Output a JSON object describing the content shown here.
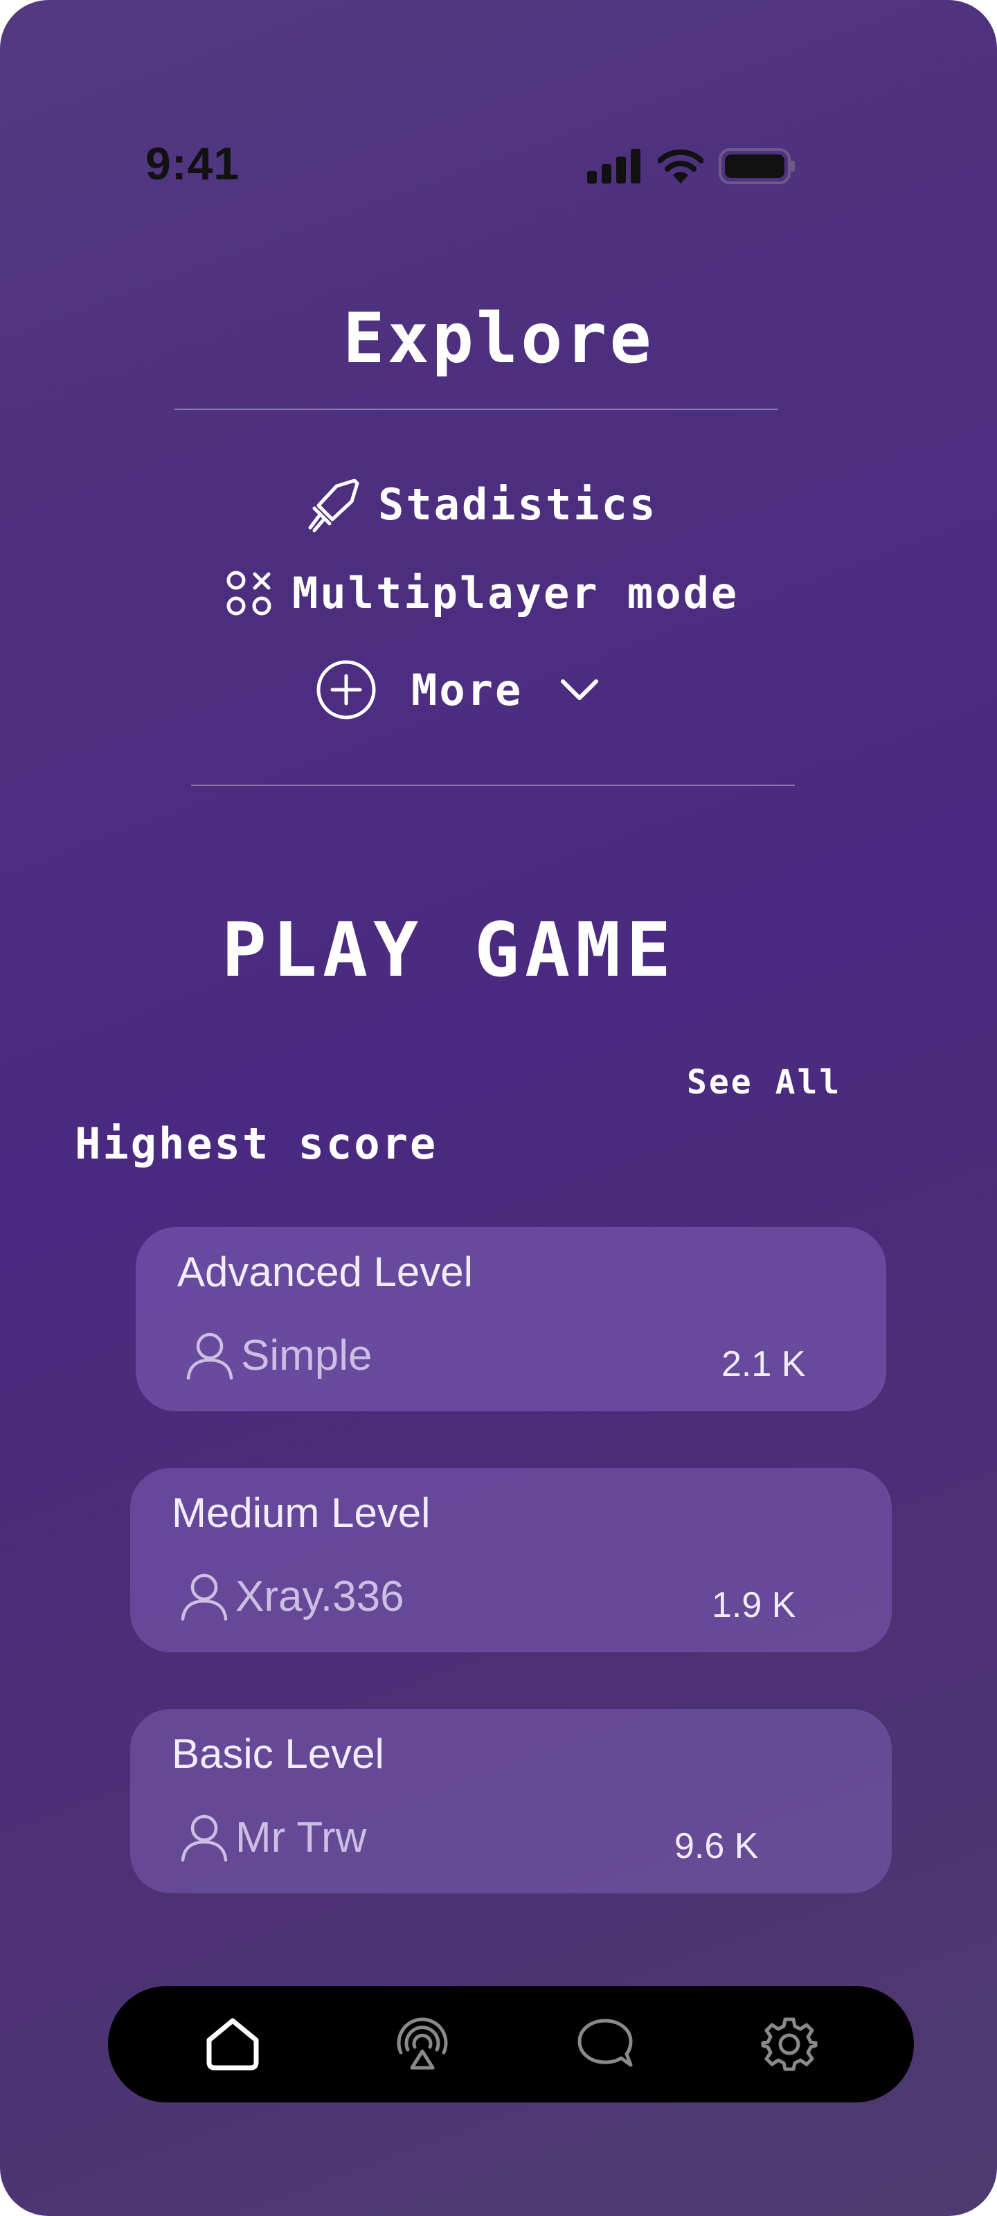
{
  "status_bar": {
    "time": "9:41"
  },
  "explore": {
    "title": "Explore",
    "items": [
      {
        "label": "Stadistics",
        "icon": "sword-icon"
      },
      {
        "label": "Multiplayer mode",
        "icon": "shapes-icon"
      },
      {
        "label": "More",
        "icon": "plus-circle-icon"
      }
    ]
  },
  "play": {
    "title": "PLAY GAME",
    "see_all": "See All",
    "section_title": "Highest score",
    "scores": [
      {
        "level": "Advanced Level",
        "user": "Simple",
        "score": "2.1 K"
      },
      {
        "level": "Medium Level",
        "user": "Xray.336",
        "score": "1.9 K"
      },
      {
        "level": "Basic Level",
        "user": "Mr Trw",
        "score": "9.6 K"
      }
    ]
  },
  "nav": {
    "items": [
      {
        "icon": "home-icon",
        "active": true
      },
      {
        "icon": "broadcast-icon",
        "active": false
      },
      {
        "icon": "chat-icon",
        "active": false
      },
      {
        "icon": "settings-icon",
        "active": false
      }
    ]
  },
  "colors": {
    "accent": "#4a2a80",
    "text": "#ffffff",
    "card": "#6a5394",
    "nav": "#000000"
  }
}
